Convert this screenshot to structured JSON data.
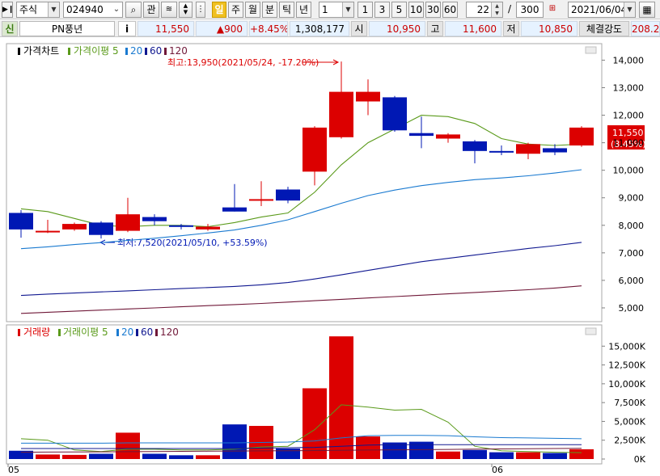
{
  "toolbar": {
    "market": "주식",
    "code": "024940",
    "btn_gwan": "관",
    "periods": [
      "일",
      "주",
      "월",
      "분",
      "틱",
      "년"
    ],
    "active_period": "일",
    "unit_value": "1",
    "unit_buttons": [
      "1",
      "3",
      "5",
      "10",
      "30",
      "60"
    ],
    "bars_shown": "22",
    "slash": "/",
    "bars_total": "300",
    "date": "2021/06/04"
  },
  "info": {
    "badge": "신",
    "name": "PN풍년",
    "info_btn": "i",
    "price": "11,550",
    "change": "▲900",
    "change_pct": "+8.45%",
    "volume": "1,308,177",
    "open_label": "시",
    "open": "10,950",
    "high_label": "고",
    "high": "11,600",
    "low_label": "저",
    "low": "10,850",
    "strength_label": "체결강도",
    "strength": "208.2"
  },
  "colors": {
    "up": "#dc0000",
    "down": "#0018b4",
    "ma5": "#5a9a1a",
    "ma20": "#1a7ad0",
    "ma60": "#101890",
    "ma120": "#701838"
  },
  "chart_data": [
    {
      "type": "candlestick",
      "legend": [
        "가격차트",
        "가격이평 5",
        "20",
        "60",
        "120"
      ],
      "y_ticks": [
        "14,000",
        "13,000",
        "12,000",
        "11,000",
        "10,000",
        "9,000",
        "8,000",
        "7,000",
        "6,000",
        "5,000"
      ],
      "ylim": [
        4500,
        14600
      ],
      "x_labels": [
        "05",
        "06"
      ],
      "x_label_index": [
        0,
        18
      ],
      "annotation_high": "최고:13,950(2021/05/24, -17.20%)",
      "annotation_low": "최저:7,520(2021/05/10, +53.59%)",
      "price_tag": "11,550",
      "price_tag_pct": "(8.45%)",
      "candles": [
        {
          "open": 8450,
          "high": 8550,
          "low": 7550,
          "close": 7850
        },
        {
          "open": 7780,
          "high": 8200,
          "low": 7720,
          "close": 7800
        },
        {
          "open": 7850,
          "high": 8100,
          "low": 7800,
          "close": 8050
        },
        {
          "open": 8100,
          "high": 8150,
          "low": 7520,
          "close": 7650
        },
        {
          "open": 7800,
          "high": 9000,
          "low": 7750,
          "close": 8400
        },
        {
          "open": 8300,
          "high": 8400,
          "low": 8000,
          "close": 8150
        },
        {
          "open": 8000,
          "high": 8050,
          "low": 7850,
          "close": 7950
        },
        {
          "open": 7850,
          "high": 8050,
          "low": 7800,
          "close": 7950
        },
        {
          "open": 8650,
          "high": 9500,
          "low": 8500,
          "close": 8500
        },
        {
          "open": 8900,
          "high": 9600,
          "low": 8700,
          "close": 8950
        },
        {
          "open": 9300,
          "high": 9400,
          "low": 8800,
          "close": 8900
        },
        {
          "open": 9950,
          "high": 11600,
          "low": 9450,
          "close": 11550
        },
        {
          "open": 11200,
          "high": 13950,
          "low": 11150,
          "close": 12850
        },
        {
          "open": 12500,
          "high": 13300,
          "low": 12000,
          "close": 12850
        },
        {
          "open": 12650,
          "high": 12700,
          "low": 11400,
          "close": 11450
        },
        {
          "open": 11350,
          "high": 11950,
          "low": 10800,
          "close": 11250
        },
        {
          "open": 11150,
          "high": 11350,
          "low": 11000,
          "close": 11300
        },
        {
          "open": 11050,
          "high": 11100,
          "low": 10250,
          "close": 10700
        },
        {
          "open": 10700,
          "high": 10900,
          "low": 10550,
          "close": 10650
        },
        {
          "open": 10600,
          "high": 11000,
          "low": 10400,
          "close": 10950
        },
        {
          "open": 10800,
          "high": 10950,
          "low": 10550,
          "close": 10650
        },
        {
          "open": 10900,
          "high": 11600,
          "low": 10850,
          "close": 11550
        }
      ],
      "series": [
        {
          "name": "5",
          "values": [
            8600,
            8500,
            8250,
            8000,
            7950,
            8000,
            8000,
            7950,
            8100,
            8300,
            8450,
            9200,
            10200,
            11000,
            11500,
            12000,
            11950,
            11700,
            11150,
            10950,
            10900,
            10950
          ]
        },
        {
          "name": "20",
          "values": [
            7150,
            7220,
            7300,
            7370,
            7450,
            7530,
            7620,
            7720,
            7830,
            8000,
            8200,
            8500,
            8800,
            9080,
            9280,
            9440,
            9560,
            9660,
            9720,
            9800,
            9900,
            10020
          ]
        },
        {
          "name": "60",
          "values": [
            5450,
            5500,
            5540,
            5580,
            5620,
            5660,
            5700,
            5740,
            5780,
            5840,
            5920,
            6050,
            6200,
            6360,
            6520,
            6680,
            6800,
            6920,
            7040,
            7160,
            7260,
            7380
          ]
        },
        {
          "name": "120",
          "values": [
            4800,
            4840,
            4880,
            4920,
            4960,
            5000,
            5040,
            5080,
            5120,
            5160,
            5210,
            5260,
            5310,
            5360,
            5410,
            5460,
            5510,
            5560,
            5610,
            5660,
            5720,
            5800
          ]
        }
      ]
    },
    {
      "type": "bar",
      "legend": [
        "거래량",
        "거래이평 5",
        "20",
        "60",
        "120"
      ],
      "y_ticks": [
        "15,000K",
        "12,500K",
        "10,000K",
        "7,500K",
        "5,000K",
        "2,500K",
        "0K"
      ],
      "ylim": [
        0,
        16000000
      ],
      "values": [
        1100000,
        600000,
        550000,
        700000,
        3500000,
        700000,
        500000,
        500000,
        4600000,
        4400000,
        1400000,
        9400000,
        16300000,
        3000000,
        2200000,
        2300000,
        1000000,
        1200000,
        900000,
        900000,
        800000,
        1300000
      ],
      "series": [
        {
          "name": "5",
          "values": [
            2700,
            2500,
            1200,
            1000,
            1300,
            1300,
            1200,
            1200,
            1300,
            1600,
            1700,
            3900,
            7200,
            6900,
            6500,
            6600,
            4900,
            1700,
            1100,
            1000,
            900,
            850
          ]
        },
        {
          "name": "20",
          "values": [
            2100,
            2100,
            2100,
            2100,
            2150,
            2150,
            2150,
            2150,
            2150,
            2200,
            2250,
            2400,
            2800,
            3100,
            3150,
            3150,
            3100,
            2950,
            2850,
            2800,
            2750,
            2700
          ]
        },
        {
          "name": "60",
          "values": [
            1400,
            1400,
            1400,
            1400,
            1400,
            1400,
            1400,
            1400,
            1400,
            1450,
            1500,
            1550,
            1700,
            1850,
            1900,
            1900,
            1900,
            1900,
            1900,
            1900,
            1900,
            1900
          ]
        },
        {
          "name": "120",
          "values": [
            900,
            920,
            940,
            960,
            980,
            1000,
            1020,
            1040,
            1060,
            1080,
            1100,
            1130,
            1160,
            1190,
            1220,
            1250,
            1280,
            1310,
            1340,
            1370,
            1400,
            1430
          ]
        }
      ]
    }
  ]
}
